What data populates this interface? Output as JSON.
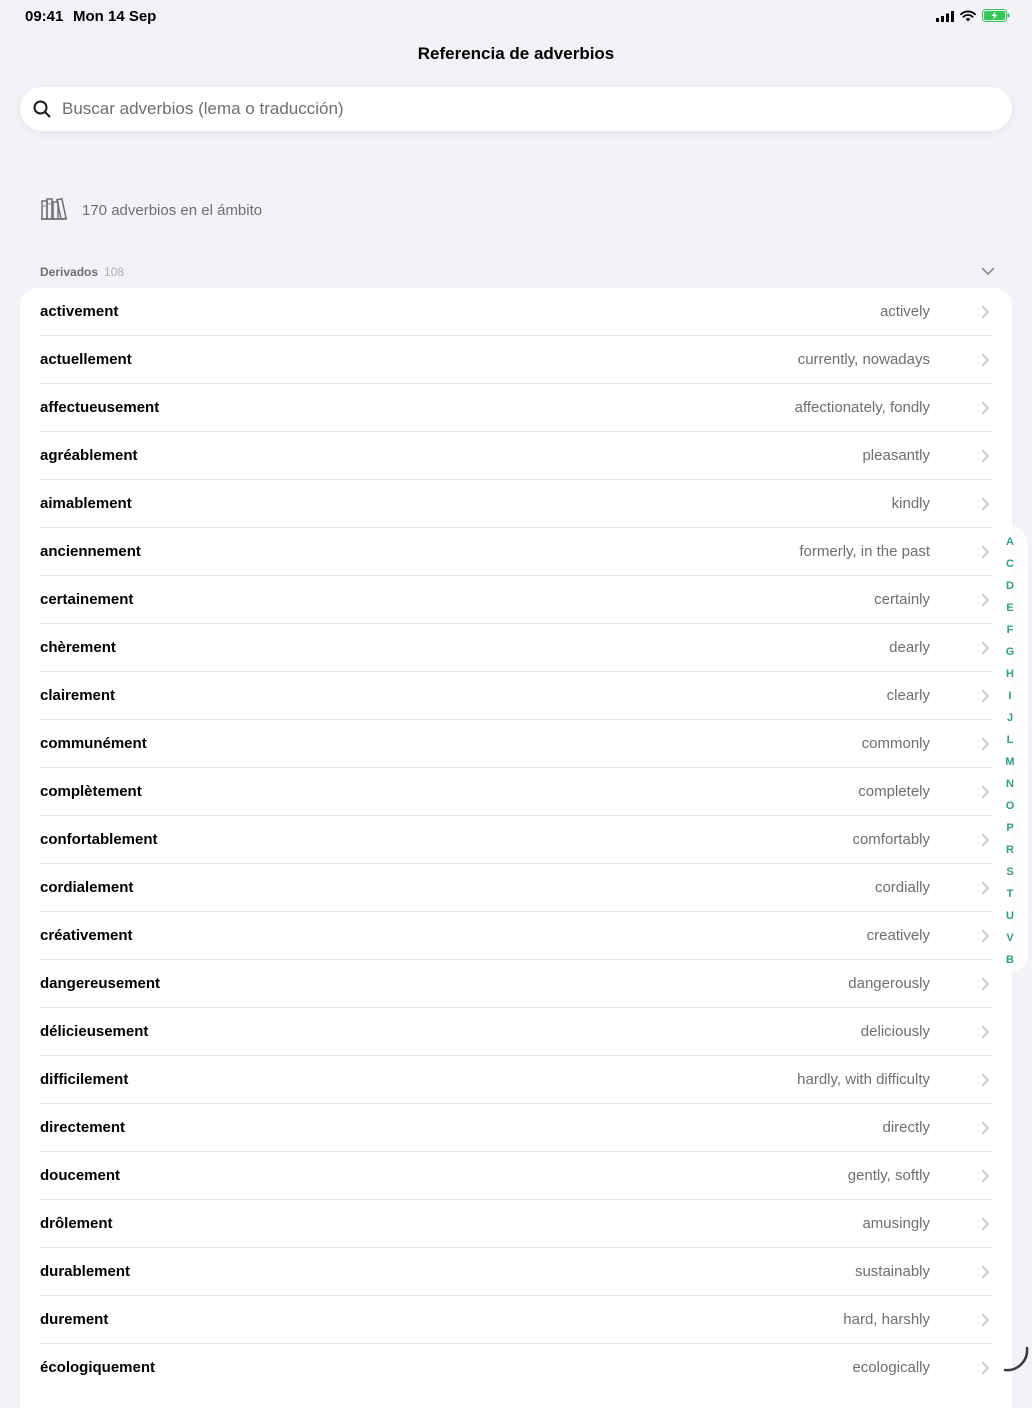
{
  "status": {
    "time": "09:41",
    "date": "Mon 14 Sep"
  },
  "nav": {
    "title": "Referencia de adverbios"
  },
  "search": {
    "placeholder": "Buscar adverbios (lema o traducción)",
    "value": ""
  },
  "scope": {
    "text": "170 adverbios en el ámbito",
    "icon": "books-icon"
  },
  "section": {
    "title": "Derivados",
    "count": "108"
  },
  "items": [
    {
      "lemma": "activement",
      "translation": "actively"
    },
    {
      "lemma": "actuellement",
      "translation": "currently, nowadays"
    },
    {
      "lemma": "affectueusement",
      "translation": "affectionately, fondly"
    },
    {
      "lemma": "agréablement",
      "translation": "pleasantly"
    },
    {
      "lemma": "aimablement",
      "translation": "kindly"
    },
    {
      "lemma": "anciennement",
      "translation": "formerly, in the past"
    },
    {
      "lemma": "certainement",
      "translation": "certainly"
    },
    {
      "lemma": "chèrement",
      "translation": "dearly"
    },
    {
      "lemma": "clairement",
      "translation": "clearly"
    },
    {
      "lemma": "communément",
      "translation": "commonly"
    },
    {
      "lemma": "complètement",
      "translation": "completely"
    },
    {
      "lemma": "confortablement",
      "translation": "comfortably"
    },
    {
      "lemma": "cordialement",
      "translation": "cordially"
    },
    {
      "lemma": "créativement",
      "translation": "creatively"
    },
    {
      "lemma": "dangereusement",
      "translation": "dangerously"
    },
    {
      "lemma": "délicieusement",
      "translation": "deliciously"
    },
    {
      "lemma": "difficilement",
      "translation": "hardly, with difficulty"
    },
    {
      "lemma": "directement",
      "translation": "directly"
    },
    {
      "lemma": "doucement",
      "translation": "gently, softly"
    },
    {
      "lemma": "drôlement",
      "translation": "amusingly"
    },
    {
      "lemma": "durablement",
      "translation": "sustainably"
    },
    {
      "lemma": "durement",
      "translation": "hard, harshly"
    },
    {
      "lemma": "écologiquement",
      "translation": "ecologically"
    }
  ],
  "index_letters": [
    "A",
    "C",
    "D",
    "E",
    "F",
    "G",
    "H",
    "I",
    "J",
    "L",
    "M",
    "N",
    "O",
    "P",
    "R",
    "S",
    "T",
    "U",
    "V",
    "B"
  ],
  "colors": {
    "accent": "#2e9e8a",
    "background": "#f2f2f7",
    "secondary_text": "#6e6e73",
    "battery": "#34c759"
  }
}
